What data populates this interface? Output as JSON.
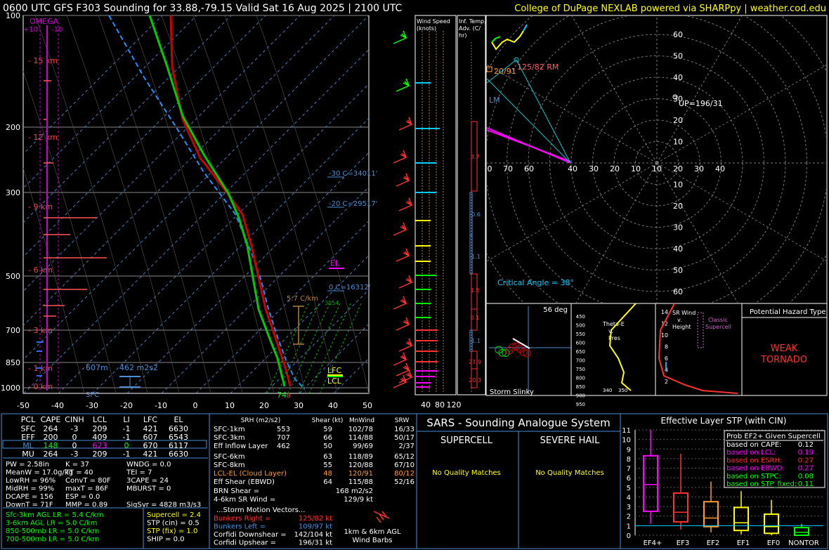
{
  "header": {
    "title": "0600 UTC GFS F303 Sounding for 33.88,-79.15 Valid  Sat 16 Aug 2025 | 2100 UTC",
    "credit": "College of DuPage NEXLAB powered via SHARPpy | weather.cod.edu"
  },
  "skewt": {
    "pressure_ticks": [
      "100",
      "200",
      "300",
      "500",
      "700",
      "850",
      "1000"
    ],
    "temp_ticks": [
      "-50",
      "-40",
      "-30",
      "-20",
      "-10",
      "0",
      "10",
      "20",
      "30",
      "40",
      "50"
    ],
    "height_labels": [
      "15 km",
      "12 km",
      "9 km",
      "6 km",
      "3 km",
      "1 km",
      "0 km"
    ],
    "omega_label": "OMEGA",
    "omega_ticks": [
      "+10",
      "-10"
    ],
    "annotations": {
      "el": "EL",
      "lfc": "LFC",
      "lcl": "LCL",
      "sfc": "SFC",
      "minus30": "-30 C=34011'",
      "minus20": "-20 C=29517'",
      "zero": "0 C=16312'",
      "lapse": "5.7 C/km",
      "ebwd_depth": "607m",
      "esrh": "462 m2s2",
      "sfc_temp": "74",
      "sfc_marker": "8",
      "wetbulb": "3054"
    },
    "colors": {
      "temperature": "#cc0000",
      "dewpoint": "#00cc00",
      "wetbulb": "#1e90ff",
      "virtual": "#cc0000"
    }
  },
  "wind_speed": {
    "title": "Wind Speed (knots)",
    "ticks": [
      "40",
      "80",
      "120"
    ]
  },
  "temp_adv": {
    "title": "Inf. Temp. Adv. (C/hr)",
    "values": [
      "3.7",
      "-0.6",
      "-1.1",
      "1.5",
      "0.1",
      "-1.1",
      "27.9",
      "20.3"
    ]
  },
  "hodograph": {
    "rings": [
      "10",
      "20",
      "30",
      "40",
      "50",
      "60"
    ],
    "axis_labels": [
      "0",
      "70",
      "60",
      "40",
      "30",
      "20",
      "10",
      "10",
      "20",
      "30",
      "40"
    ],
    "rm": "125/82 RM",
    "lm": "LM",
    "up": "UP=196/31",
    "dn": "20/91",
    "critical_angle": "Critical Angle = 38°"
  },
  "slinky": {
    "title": "Storm Slinky",
    "deg": "56 deg"
  },
  "theta": {
    "label": "Theta-E v. Pres",
    "ticks": [
      "450",
      "500",
      "550",
      "600",
      "650",
      "700",
      "750",
      "800",
      "850",
      "900",
      "950"
    ],
    "xticks": [
      "340",
      "350"
    ]
  },
  "srwind": {
    "label": "SR Wind v. Height",
    "tag": "Classic Supercell",
    "ticks": [
      "14",
      "12",
      "10",
      "8",
      "6",
      "4",
      "2"
    ]
  },
  "hazard": {
    "title": "Potential Hazard Type",
    "value": "WEAK TORNADO"
  },
  "parcels": {
    "header": [
      "PCL",
      "CAPE",
      "CINH",
      "LCL",
      "LI",
      "LFC",
      "EL"
    ],
    "rows": [
      [
        "SFC",
        "264",
        "-3",
        "209",
        "-1",
        "421",
        "6630"
      ],
      [
        "EFF",
        "200",
        "0",
        "409",
        "-1",
        "607",
        "6543"
      ],
      [
        "ML",
        "148",
        "0",
        "623",
        "0",
        "670",
        "6117"
      ],
      [
        "MU",
        "264",
        "-3",
        "209",
        "-1",
        "421",
        "6630"
      ]
    ]
  },
  "indices": [
    [
      "PW = 2.58in",
      "K = 37",
      "WNDG = 0.0"
    ],
    [
      "MeanW = 17.0g/kg",
      "TT = 40",
      "TEI = 7"
    ],
    [
      "LowRH = 96%",
      "ConvT = 80F",
      "3CAPE = 24"
    ],
    [
      "MidRH = 99%",
      "maxT = 86F",
      "MBURST = 0"
    ],
    [
      "DCAPE = 156",
      "ESP = 0.0",
      ""
    ],
    [
      "DownT = 71F",
      "MMP = 0.89",
      "SigSvr = 4828 m3/s3"
    ]
  ],
  "lapse_rates": [
    "Sfc-3km AGL LR = 5.4 C/km",
    "3-6km AGL LR = 5.0 C/km",
    "850-500mb LR = 5.0 C/km",
    "700-500mb LR = 5.0 C/km"
  ],
  "composites": [
    "Supercell = 2.4",
    "STP (cin) = 0.5",
    "STP (fix) = 1.0",
    "SHIP = 0.0"
  ],
  "kinematics": {
    "header": [
      "SRH (m2/s2)",
      "Shear (kt)",
      "MnWind",
      "SRW"
    ],
    "rows": [
      [
        "SFC-1km",
        "553",
        "59",
        "102/78",
        "16/33"
      ],
      [
        "SFC-3km",
        "707",
        "66",
        "114/88",
        "50/17"
      ],
      [
        "Eff Inflow Layer",
        "462",
        "50",
        "99/69",
        "2/37"
      ],
      [
        "",
        "",
        "",
        "",
        ""
      ],
      [
        "SFC-6km",
        "63",
        "118/89",
        "65/12",
        ""
      ],
      [
        "SFC-8km",
        "55",
        "120/88",
        "67/10",
        ""
      ],
      [
        "LCL-EL (Cloud Layer)",
        "48",
        "120/91",
        "80/12",
        ""
      ],
      [
        "Eff Shear (EBWD)",
        "64",
        "115/88",
        "52/16",
        ""
      ]
    ],
    "brn": [
      "BRN Shear =",
      "168 m2/s2"
    ],
    "sr46": [
      "4-6km SR Wind =",
      "129/9 kt"
    ],
    "motion_title": "...Storm Motion Vectors...",
    "motions": [
      [
        "Bunkers Right =",
        "125/82 kt"
      ],
      [
        "Bunkers Left =",
        "109/97 kt"
      ],
      [
        "Corfidi Downshear =",
        "142/104 kt"
      ],
      [
        "Corfidi Upshear =",
        "196/31 kt"
      ]
    ],
    "barbs_label": "1km & 6km AGL Wind Barbs"
  },
  "sars": {
    "title": "SARS - Sounding Analogue System",
    "supercell": "SUPERCELL",
    "hail": "SEVERE HAIL",
    "supercell_result": "No Quality Matches",
    "hail_result": "No Quality Matches"
  },
  "stp_panel": {
    "title": "Effective Layer STP (with CIN)",
    "prob_title": "Prob EF2+ Given Supercell",
    "probs": [
      [
        "based on CAPE:",
        "0.12"
      ],
      [
        "based on LCL:",
        "0.19"
      ],
      [
        "based on ESRH:",
        "0.27"
      ],
      [
        "based on EBWD:",
        "0.27"
      ],
      [
        "based on STPC:",
        "0.08"
      ],
      [
        "based on STP_fixed:",
        "0.11"
      ]
    ]
  },
  "chart_data": {
    "type": "box",
    "title": "Effective Layer STP (with CIN)",
    "categories": [
      "EF4+",
      "EF3",
      "EF2",
      "EF1",
      "EF0",
      "NONTOR"
    ],
    "yticks": [
      "0",
      "1",
      "2",
      "3",
      "4",
      "5",
      "6",
      "7",
      "8",
      "9",
      "10",
      "11"
    ],
    "ylim": [
      0,
      11
    ],
    "boxes": [
      {
        "min": 1.2,
        "q1": 2.5,
        "median": 5.3,
        "q3": 8.3,
        "max": 11.0
      },
      {
        "min": 0.6,
        "q1": 1.4,
        "median": 2.4,
        "q3": 4.4,
        "max": 8.5
      },
      {
        "min": 0.3,
        "q1": 0.9,
        "median": 1.8,
        "q3": 3.5,
        "max": 5.6
      },
      {
        "min": 0.1,
        "q1": 0.5,
        "median": 1.3,
        "q3": 2.9,
        "max": 4.6
      },
      {
        "min": 0.0,
        "q1": 0.2,
        "median": 0.9,
        "q3": 2.2,
        "max": 3.7
      },
      {
        "min": 0.0,
        "q1": 0.0,
        "median": 0.3,
        "q3": 0.8,
        "max": 1.2
      }
    ],
    "colors": [
      "#ff00ff",
      "#ff3030",
      "#ff9a30",
      "#ffff00",
      "#ffff00",
      "#00ff00"
    ],
    "current_value": 1.0
  }
}
